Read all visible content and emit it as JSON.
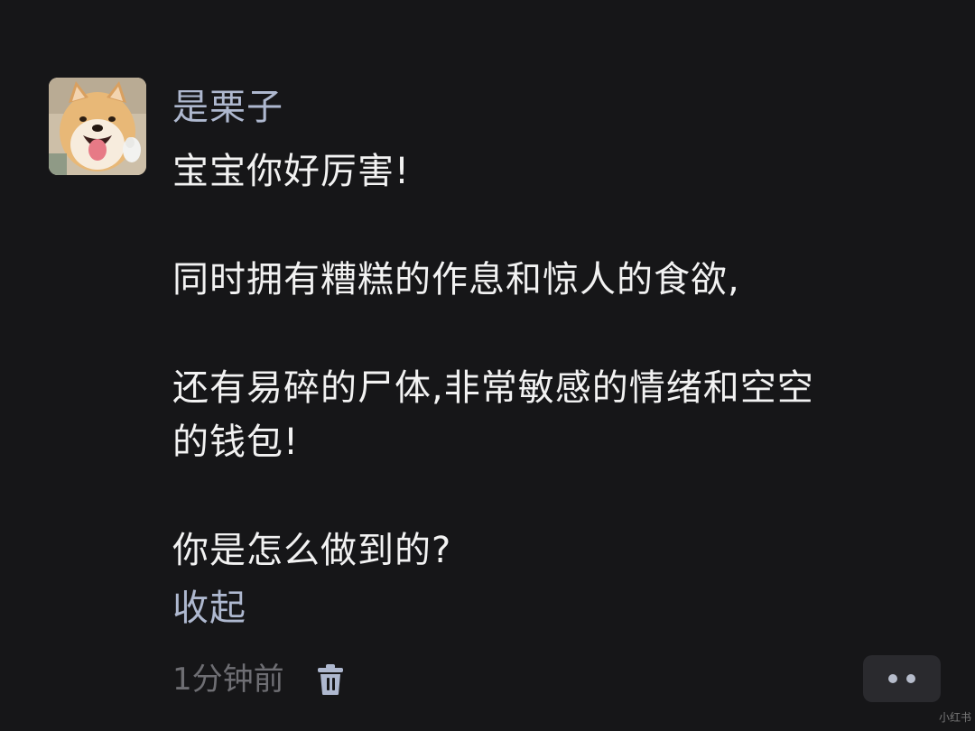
{
  "comment": {
    "username": "是栗子",
    "avatar": {
      "alt": "shiba-inu-dog-avatar"
    },
    "lines": [
      "宝宝你好厉害!",
      "",
      "同时拥有糟糕的作息和惊人的食欲,",
      "",
      "还有易碎的尸体,非常敏感的情绪和空空",
      "的钱包!",
      "",
      "你是怎么做到的?"
    ],
    "collapse_label": "收起",
    "timestamp": "1分钟前",
    "delete_icon": "trash-icon",
    "more_icon": "more-dots-icon"
  },
  "colors": {
    "background": "#161618",
    "username": "#aeb8cf",
    "body_text": "#f2f2f2",
    "link": "#aeb8cf",
    "muted": "#6e6e73"
  },
  "watermark": "小红书"
}
